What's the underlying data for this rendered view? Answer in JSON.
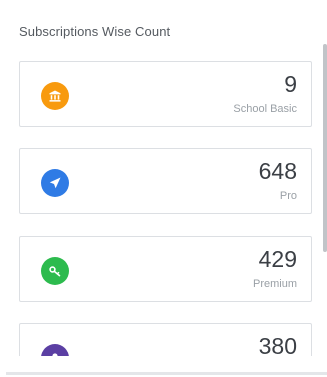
{
  "section": {
    "title": "Subscriptions Wise Count"
  },
  "subscriptions": [
    {
      "count": "9",
      "plan": "School Basic",
      "icon": "bank-icon",
      "color": "#f89a0e"
    },
    {
      "count": "648",
      "plan": "Pro",
      "icon": "rocket-icon",
      "color": "#2f7be5"
    },
    {
      "count": "429",
      "plan": "Premium",
      "icon": "key-icon",
      "color": "#2dbb4e"
    },
    {
      "count": "380",
      "plan": "",
      "icon": "user-icon",
      "color": "#5b3fa3"
    }
  ]
}
